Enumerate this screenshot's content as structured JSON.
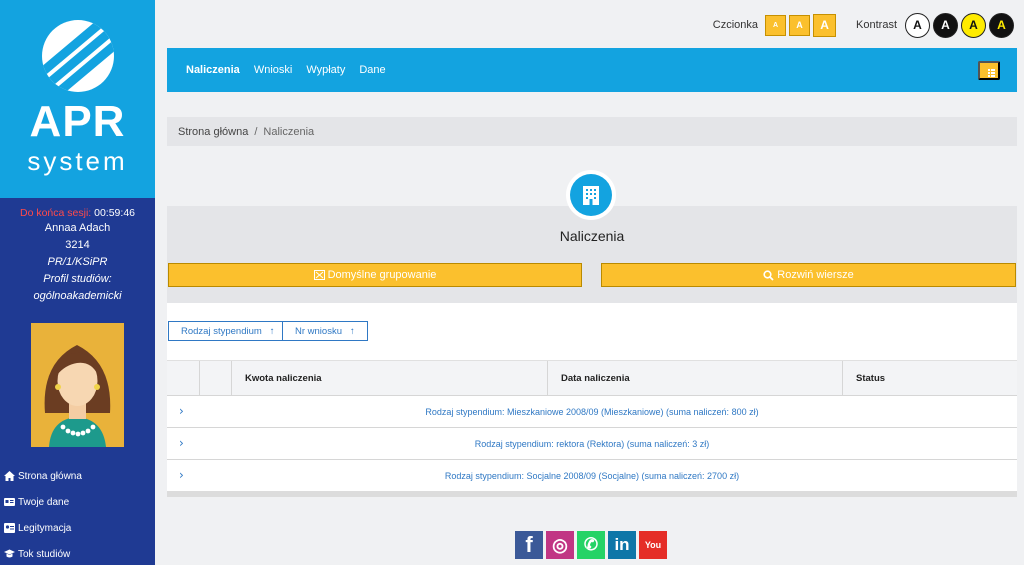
{
  "brand": {
    "name_line1": "APR",
    "name_line2": "system"
  },
  "session": {
    "label": "Do końca sesji:",
    "time": "00:59:46",
    "user_name": "Annaa Adach",
    "user_id": "3214",
    "program": "PR/1/KSiPR",
    "profile_label": "Profil studiów:",
    "profile_value": "ogólnoakademicki"
  },
  "sidebar_nav": [
    {
      "label": "Strona główna",
      "icon": "home-icon"
    },
    {
      "label": "Twoje dane",
      "icon": "id-card-icon"
    },
    {
      "label": "Legitymacja",
      "icon": "badge-icon"
    },
    {
      "label": "Tok studiów",
      "icon": "graduation-cap-icon"
    }
  ],
  "accessibility": {
    "font_label": "Czcionka",
    "font_buttons": [
      "A",
      "A",
      "A"
    ],
    "contrast_label": "Kontrast",
    "contrast_buttons": [
      "A",
      "A",
      "A",
      "A"
    ]
  },
  "topnav": {
    "links": [
      {
        "label": "Naliczenia",
        "active": true
      },
      {
        "label": "Wnioski",
        "active": false
      },
      {
        "label": "Wypłaty",
        "active": false
      },
      {
        "label": "Dane",
        "active": false
      }
    ]
  },
  "breadcrumb": {
    "home": "Strona główna",
    "separator": "/",
    "current": "Naliczenia"
  },
  "panel": {
    "title": "Naliczenia",
    "button_grouping": "Domyślne grupowanie",
    "button_expand": "Rozwiń wiersze"
  },
  "sort_buttons": [
    {
      "label": "Rodzaj stypendium",
      "arrow": "↑"
    },
    {
      "label": "Nr wniosku",
      "arrow": "↑"
    }
  ],
  "table": {
    "headers": [
      "Kwota naliczenia",
      "Data naliczenia",
      "Status"
    ],
    "groups": [
      "Rodzaj stypendium: Mieszkaniowe 2008/09 (Mieszkaniowe) (suma naliczeń: 800 zł)",
      "Rodzaj stypendium: rektora (Rektora) (suma naliczeń: 3 zł)",
      "Rodzaj stypendium: Socjalne 2008/09 (Socjalne) (suma naliczeń: 2700 zł)"
    ]
  },
  "social": [
    {
      "name": "facebook-icon",
      "glyph": "f",
      "color": "#3b5998"
    },
    {
      "name": "instagram-icon",
      "glyph": "◎",
      "color": "#c13584"
    },
    {
      "name": "whatsapp-icon",
      "glyph": "✆",
      "color": "#25d366"
    },
    {
      "name": "linkedin-icon",
      "glyph": "in",
      "color": "#0e76a8"
    },
    {
      "name": "youtube-icon",
      "glyph": "You",
      "color": "#e52d27"
    }
  ],
  "colors": {
    "primary": "#13a3e0",
    "sidebar": "#1f3a93",
    "accent": "#fbc02d",
    "link": "#2f78c4"
  }
}
